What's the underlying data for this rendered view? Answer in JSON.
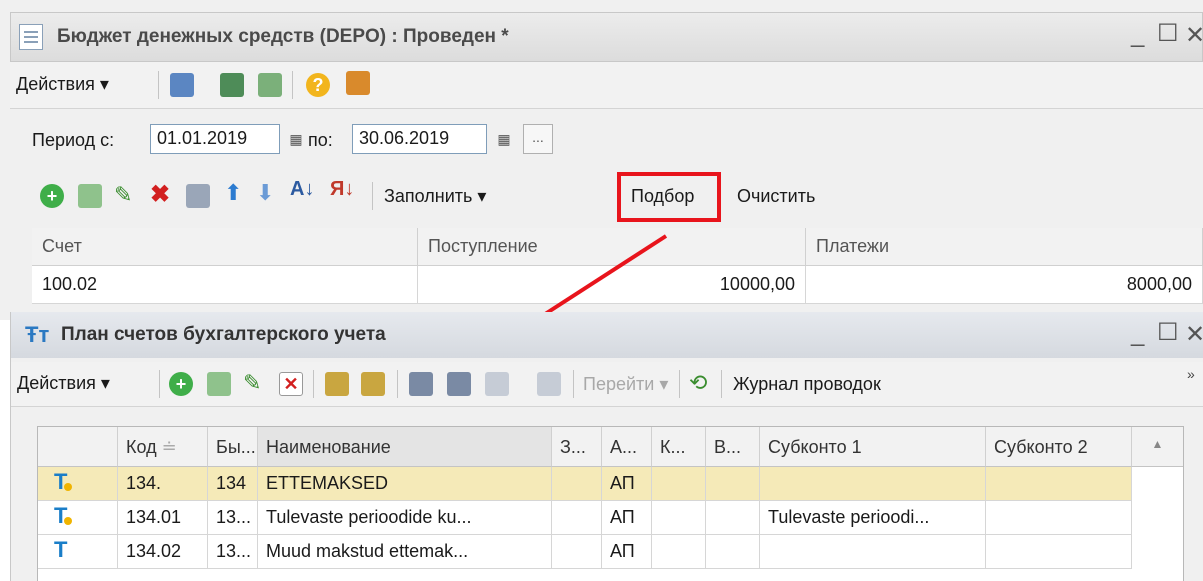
{
  "doc_window": {
    "title": "Бюджет денежных средств (DEPO) : Проведен *",
    "toolbar": {
      "actions_label": "Действия ▾"
    },
    "period": {
      "from_label": "Период с:",
      "from_value": "01.01.2019",
      "to_label": "по:",
      "to_value": "30.06.2019",
      "more_label": "..."
    },
    "table_toolbar": {
      "fill_label": "Заполнить ▾",
      "select_label": "Подбор",
      "clear_label": "Очистить"
    },
    "columns": [
      "Счет",
      "Поступление",
      "Платежи"
    ],
    "rows": [
      {
        "account": "100.02",
        "income": "10000,00",
        "payments": "8000,00"
      }
    ]
  },
  "chart_window": {
    "title": "План счетов бухгалтерского учета",
    "toolbar": {
      "actions_label": "Действия ▾",
      "goto_label": "Перейти ▾",
      "journal_label": "Журнал проводок"
    },
    "columns": [
      "",
      "Код",
      "Бы...",
      "Наименование",
      "З...",
      "А...",
      "К...",
      "В...",
      "Субконто 1",
      "Субконто 2"
    ],
    "rows": [
      {
        "code": "134.",
        "fast": "134",
        "name": "ETTEMAKSED",
        "z": "",
        "a": "АП",
        "k": "",
        "v": "",
        "sub1": "",
        "sub2": ""
      },
      {
        "code": "134.01",
        "fast": "13...",
        "name": "Tulevaste perioodide ku...",
        "z": "",
        "a": "АП",
        "k": "",
        "v": "",
        "sub1": "Tulevaste perioodi...",
        "sub2": ""
      },
      {
        "code": "134.02",
        "fast": "13...",
        "name": "Muud makstud ettemak...",
        "z": "",
        "a": "АП",
        "k": "",
        "v": "",
        "sub1": "",
        "sub2": ""
      }
    ]
  },
  "colors": {
    "highlight_box": "#e8141c",
    "arrow": "#e8141c",
    "selected_row": "#f5eab8"
  },
  "icons": [
    "document-icon",
    "add-icon",
    "copy-icon",
    "edit-icon",
    "delete-icon",
    "move-up-icon",
    "move-down-icon",
    "sort-asc-icon",
    "sort-desc-icon",
    "help-icon",
    "refresh-icon",
    "filter-icon"
  ]
}
